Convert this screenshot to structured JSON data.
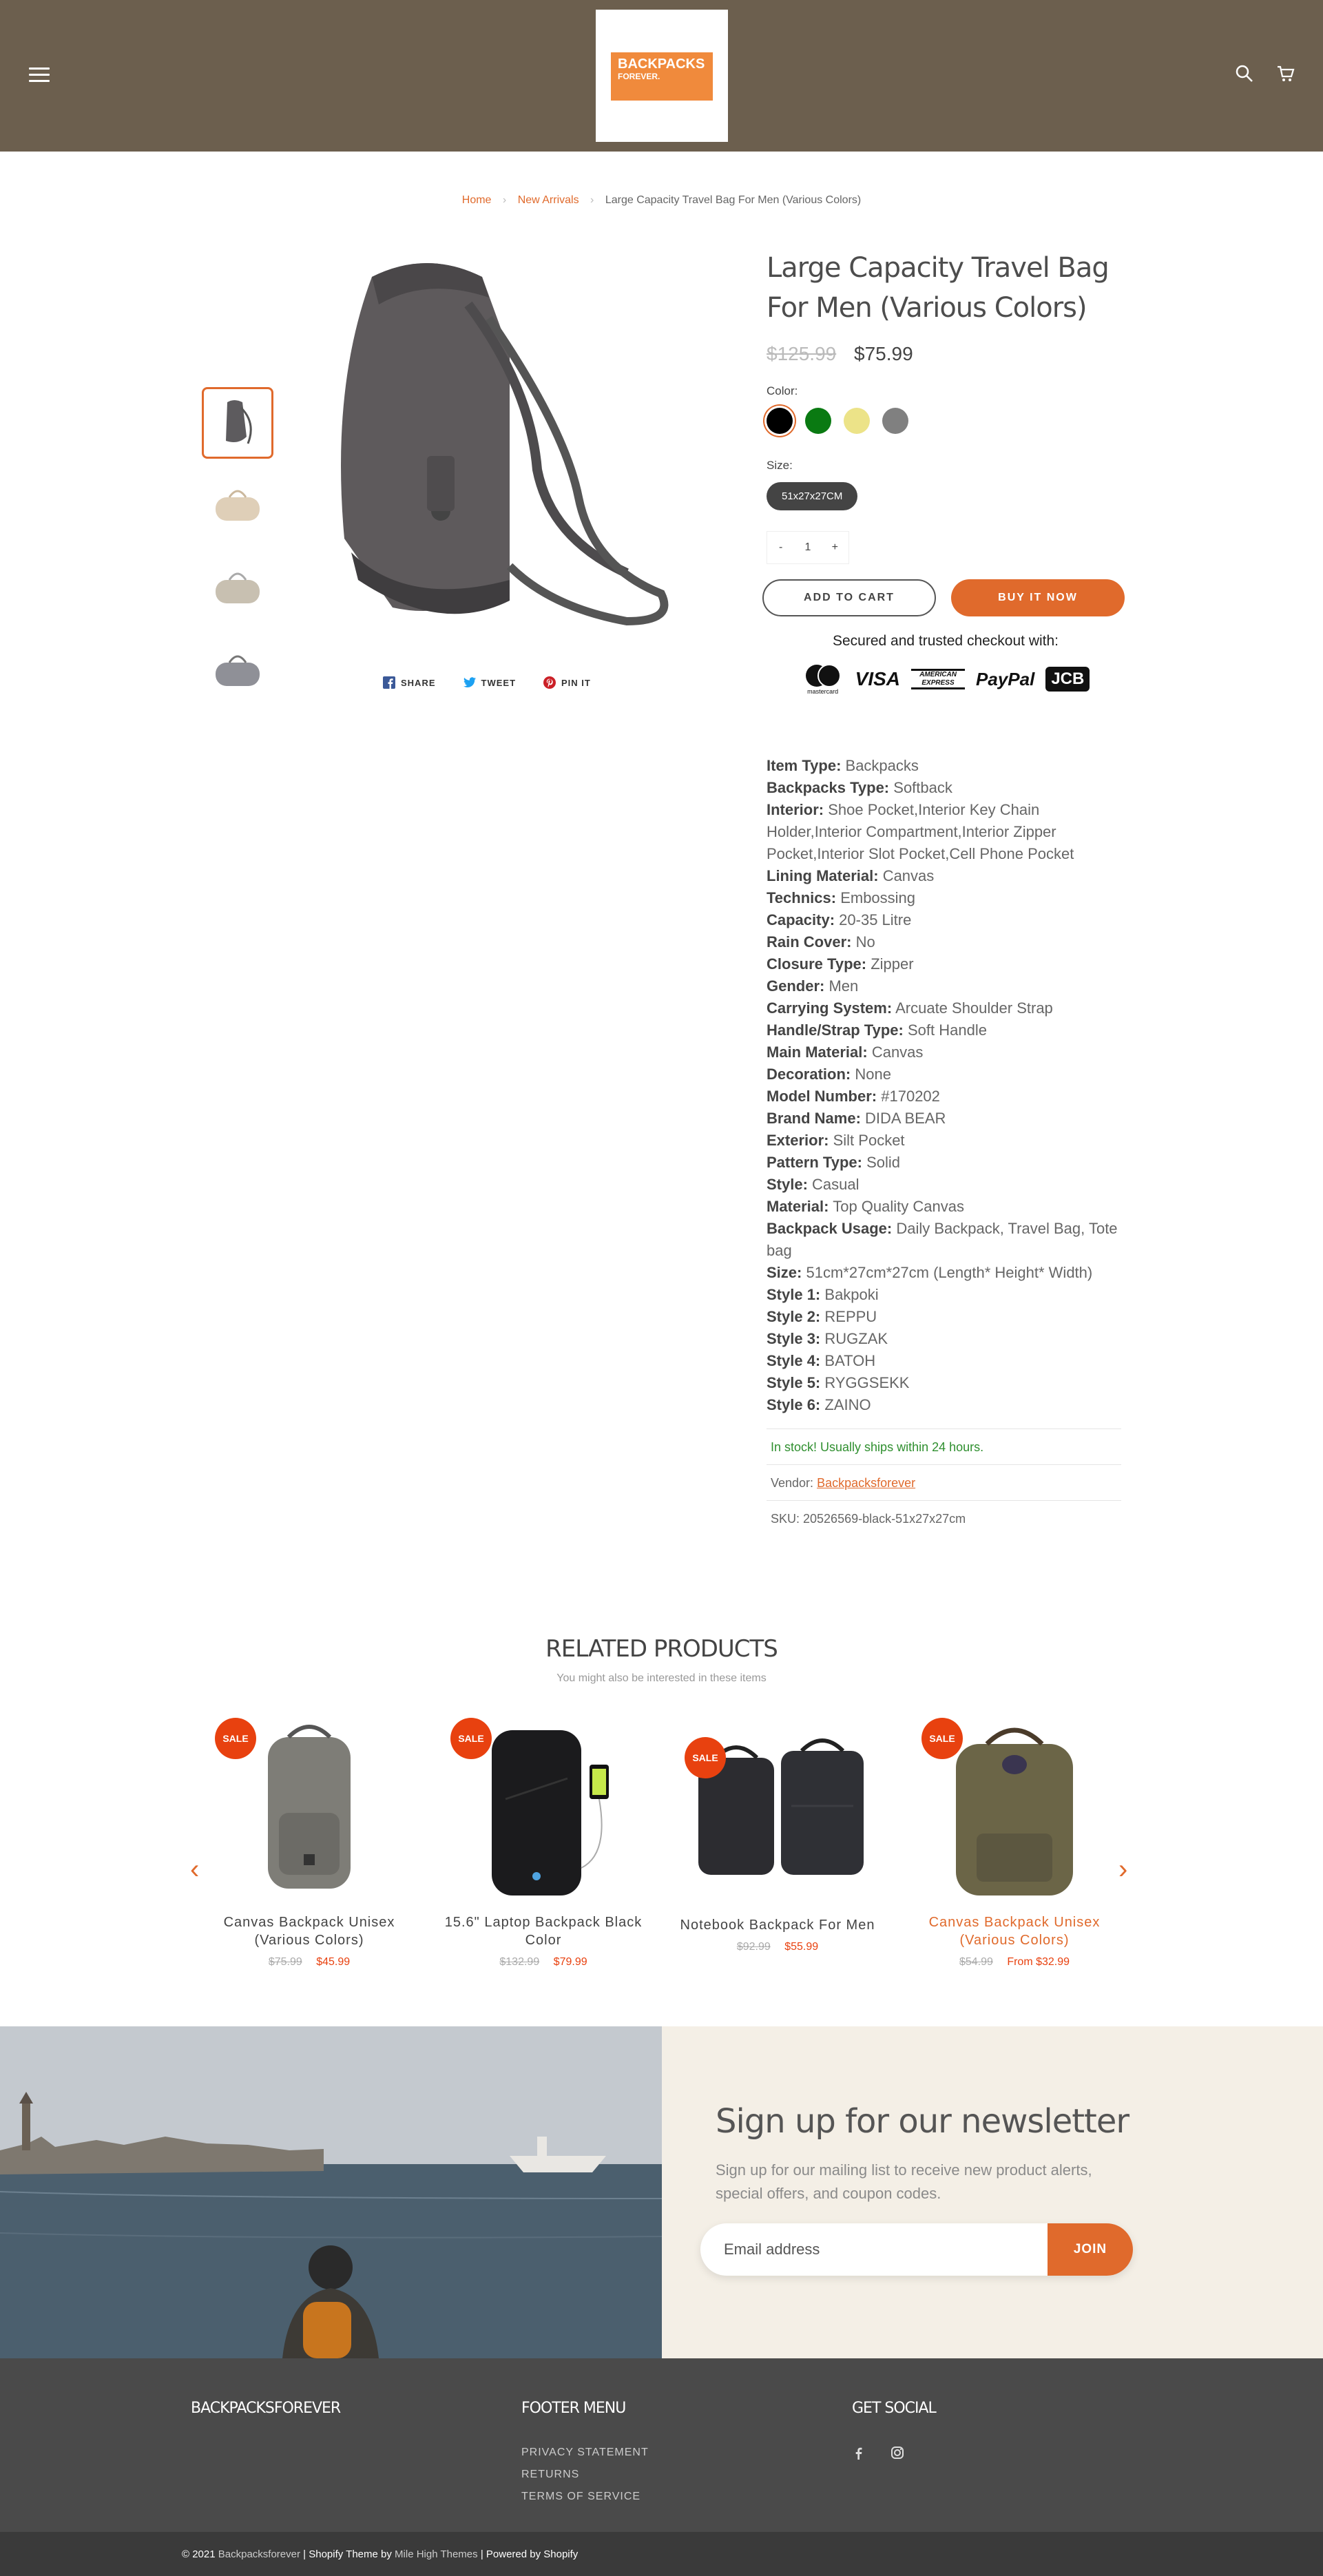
{
  "header": {
    "logo_line1": "BACKPACKS",
    "logo_line2": "FOREVER."
  },
  "breadcrumb": {
    "home": "Home",
    "category": "New Arrivals",
    "current": "Large Capacity Travel Bag For Men (Various Colors)"
  },
  "share": {
    "share": "SHARE",
    "tweet": "TWEET",
    "pin": "PIN IT"
  },
  "product": {
    "title": "Large Capacity Travel Bag For Men (Various Colors)",
    "old_price": "$125.99",
    "price": "$75.99",
    "color_label": "Color:",
    "colors": [
      "#000000",
      "#0a7a12",
      "#ece388",
      "#808080"
    ],
    "size_label": "Size:",
    "size_value": "51x27x27CM",
    "qty_minus": "-",
    "qty_value": "1",
    "qty_plus": "+",
    "add_to_cart": "ADD TO CART",
    "buy_now": "BUY IT NOW",
    "secure_text": "Secured and trusted checkout with:",
    "cards": [
      "mastercard",
      "VISA",
      "AMERICAN EXPRESS",
      "PayPal",
      "JCB"
    ]
  },
  "specs": [
    {
      "k": "Item Type:",
      "v": "Backpacks"
    },
    {
      "k": "Backpacks Type:",
      "v": "Softback"
    },
    {
      "k": "Interior:",
      "v": "Shoe Pocket,Interior Key Chain Holder,Interior Compartment,Interior Zipper Pocket,Interior Slot Pocket,Cell Phone Pocket"
    },
    {
      "k": "Lining Material:",
      "v": "Canvas"
    },
    {
      "k": "Technics:",
      "v": "Embossing"
    },
    {
      "k": "Capacity:",
      "v": "20-35 Litre"
    },
    {
      "k": "Rain Cover:",
      "v": "No"
    },
    {
      "k": "Closure Type:",
      "v": "Zipper"
    },
    {
      "k": "Gender:",
      "v": "Men"
    },
    {
      "k": "Carrying System:",
      "v": "Arcuate Shoulder Strap"
    },
    {
      "k": "Handle/Strap Type:",
      "v": "Soft Handle"
    },
    {
      "k": "Main Material:",
      "v": "Canvas"
    },
    {
      "k": "Decoration:",
      "v": "None"
    },
    {
      "k": "Model Number:",
      "v": "#170202"
    },
    {
      "k": "Brand Name:",
      "v": "DIDA BEAR"
    },
    {
      "k": "Exterior:",
      "v": "Silt Pocket"
    },
    {
      "k": "Pattern Type:",
      "v": "Solid"
    },
    {
      "k": "Style:",
      "v": "Casual"
    },
    {
      "k": "Material:",
      "v": "Top Quality Canvas"
    },
    {
      "k": "Backpack Usage:",
      "v": "Daily Backpack, Travel Bag, Tote bag"
    },
    {
      "k": "Size:",
      "v": "51cm*27cm*27cm (Length* Height* Width)"
    },
    {
      "k": "Style 1:",
      "v": "Bakpoki"
    },
    {
      "k": "Style 2:",
      "v": "REPPU"
    },
    {
      "k": "Style 3:",
      "v": "RUGZAK"
    },
    {
      "k": "Style 4:",
      "v": "BATOH"
    },
    {
      "k": "Style 5:",
      "v": "RYGGSEKK"
    },
    {
      "k": "Style 6:",
      "v": "ZAINO"
    }
  ],
  "meta": {
    "stock": "In stock! Usually ships within 24 hours.",
    "vendor_label": "Vendor:",
    "vendor": "Backpacksforever",
    "sku": "SKU: 20526569-black-51x27x27cm"
  },
  "related": {
    "title": "RELATED PRODUCTS",
    "subtitle": "You might also be interested in these items",
    "sale_badge": "SALE",
    "items": [
      {
        "name": "Canvas Backpack Unisex (Various Colors)",
        "was": "$75.99",
        "now": "$45.99"
      },
      {
        "name": "15.6\" Laptop Backpack Black Color",
        "was": "$132.99",
        "now": "$79.99"
      },
      {
        "name": "Notebook Backpack For Men",
        "was": "$92.99",
        "now": "$55.99"
      },
      {
        "name": "Canvas Backpack Unisex (Various Colors)",
        "was": "$54.99",
        "now": "From $32.99"
      }
    ],
    "prev": "‹",
    "next": "›"
  },
  "newsletter": {
    "title": "Sign up for our newsletter",
    "text": "Sign up for our mailing list to receive new product alerts, special offers, and coupon codes.",
    "placeholder": "Email address",
    "join": "JOIN"
  },
  "footer": {
    "brand": "BACKPACKSFOREVER",
    "menu_title": "FOOTER MENU",
    "menu": [
      "PRIVACY STATEMENT",
      "RETURNS",
      "TERMS OF SERVICE"
    ],
    "social_title": "GET SOCIAL",
    "copyright_year": "© 2021",
    "copyright_brand": "Backpacksforever",
    "shopify_theme": "| Shopify",
    "theme_word": "Theme",
    "by": "by",
    "theme_author": "Mile High Themes",
    "powered": "| Powered by Shopify"
  }
}
